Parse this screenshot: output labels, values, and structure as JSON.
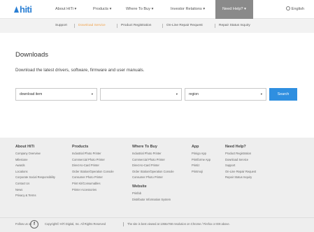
{
  "brand": {
    "logo_text": "hiti"
  },
  "topnav": {
    "items": [
      {
        "label": "About HiTi"
      },
      {
        "label": "Products"
      },
      {
        "label": "Where To Buy"
      },
      {
        "label": "Investor Relations"
      },
      {
        "label": "Need Help?"
      }
    ],
    "chevron": "▾",
    "language": "English",
    "language_icon": "globe-icon"
  },
  "subnav": {
    "items": [
      {
        "label": "Support"
      },
      {
        "label": "Download Service"
      },
      {
        "label": "Product Registration"
      },
      {
        "label": "On-Line Repair Request"
      },
      {
        "label": "Repair Status Inquiry"
      }
    ],
    "active_color": "#f0a24a"
  },
  "main": {
    "title": "Downloads",
    "description": "Download the latest drivers, software, firmware and user manuals.",
    "selects": [
      {
        "value": "download item"
      },
      {
        "value": ""
      },
      {
        "value": "region"
      }
    ],
    "caret": "▾",
    "search_label": "Search",
    "accent_color": "#2f8fe0"
  },
  "footer": {
    "columns": [
      {
        "heading": "About HiTi",
        "links": [
          "Company Overview",
          "Milestone",
          "Awards",
          "Locations",
          "Corporate Social Responsibility",
          "Contact Us",
          "News",
          "Privacy & Terms"
        ]
      },
      {
        "heading": "Products",
        "links": [
          "Industrial Photo Printer",
          "Commercial Photo Printer",
          "Direct-to-Card Printer",
          "Order Station/Operation Console",
          "Consumer Photo Printer",
          "Print Kit/Consumables",
          "Printer Accessories"
        ]
      },
      {
        "heading": "Where To Buy",
        "links": [
          "Industrial Photo Printer",
          "Commercial Photo Printer",
          "Direct-to-Card Printer",
          "Order Station/Operation Console",
          "Consumer Photo Printer"
        ],
        "heading2": "Website",
        "links2": [
          "Prinfab",
          "Distributor Information System"
        ]
      },
      {
        "heading": "App",
        "links": [
          "Prinigo App",
          "Printforme App",
          "Printiz",
          "Printmoji"
        ]
      },
      {
        "heading": "Need Help?",
        "links": [
          "Product Registration",
          "Download Service",
          "Support",
          "On-Line Repair Request",
          "Repair Status Inquiry"
        ]
      }
    ],
    "follow_us": "Follow us on",
    "facebook_icon": "facebook-icon",
    "facebook_glyph": "f",
    "copyright": "Copyright© HiTi Digital, Inc. All Rights Reserved",
    "browser_note": "The site is best viewed at 1366x768 resolution on Chrome / Firefox or IE8 above."
  }
}
